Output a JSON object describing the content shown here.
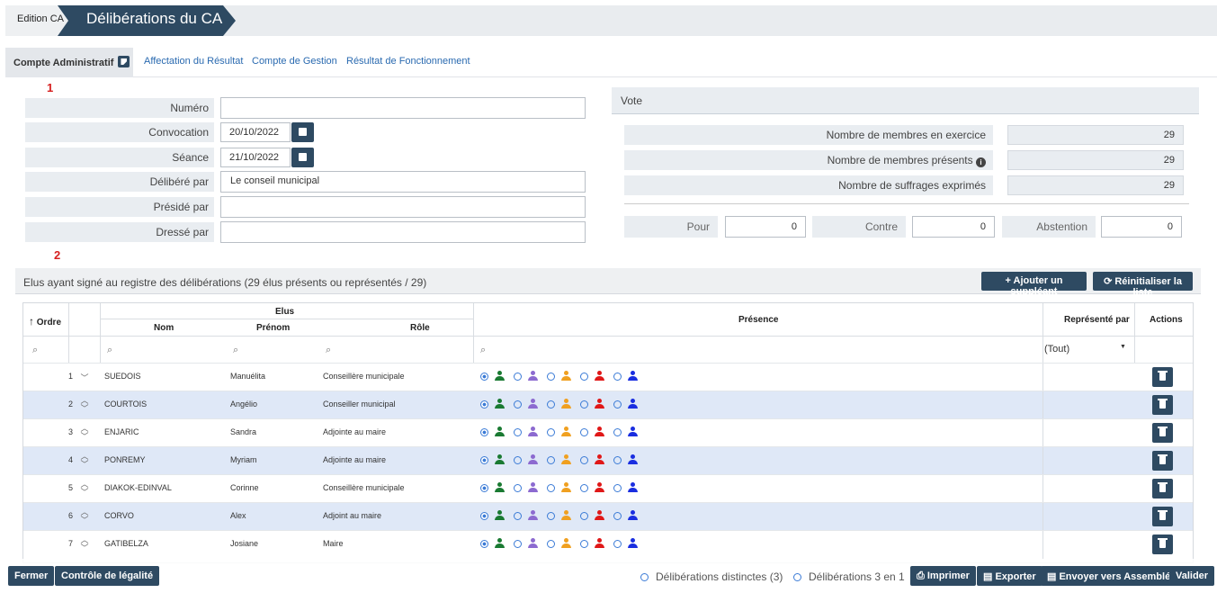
{
  "breadcrumb": {
    "parent": "Edition CA",
    "current": "Délibérations du CA"
  },
  "tabs": [
    "Compte Administratif",
    "Affectation du Résultat",
    "Compte de Gestion",
    "Résultat de Fonctionnement"
  ],
  "markers": [
    "1",
    "2"
  ],
  "form": {
    "numero": {
      "label": "Numéro",
      "value": ""
    },
    "convocation": {
      "label": "Convocation",
      "value": "20/10/2022"
    },
    "seance": {
      "label": "Séance",
      "value": "21/10/2022"
    },
    "delibere_par": {
      "label": "Délibéré par",
      "value": "Le conseil municipal"
    },
    "preside_par": {
      "label": "Présidé par",
      "value": ""
    },
    "dresse_par": {
      "label": "Dressé par",
      "value": ""
    }
  },
  "vote": {
    "title": "Vote",
    "membres_exercice_label": "Nombre de membres en exercice",
    "membres_exercice": "29",
    "membres_presents_label": "Nombre de membres présents",
    "membres_presents": "29",
    "suffrages_label": "Nombre de suffrages exprimés",
    "suffrages": "29",
    "pour_label": "Pour",
    "pour": "0",
    "contre_label": "Contre",
    "contre": "0",
    "abstention_label": "Abstention",
    "abstention": "0"
  },
  "elus_section": {
    "title": "Elus ayant signé au registre des délibérations (29 élus présents ou représentés / 29)",
    "add_label": "+ Ajouter un suppléant",
    "reset_label": "Réinitialiser la liste"
  },
  "grid": {
    "ordre": "Ordre",
    "elus": "Elus",
    "nom": "Nom",
    "prenom": "Prénom",
    "role": "Rôle",
    "presence": "Présence",
    "represente": "Représenté par",
    "actions": "Actions",
    "filter_all": "(Tout)"
  },
  "presence_colors": [
    "#1a7a32",
    "#8c6ad0",
    "#f0a020",
    "#e01818",
    "#1a2ee0"
  ],
  "rows": [
    {
      "ordre": "1",
      "nom": "SUEDOIS",
      "prenom": "Manuélita",
      "role": "Conseillère municipale"
    },
    {
      "ordre": "2",
      "nom": "COURTOIS",
      "prenom": "Angélio",
      "role": "Conseiller municipal"
    },
    {
      "ordre": "3",
      "nom": "ENJARIC",
      "prenom": "Sandra",
      "role": "Adjointe au maire"
    },
    {
      "ordre": "4",
      "nom": "PONREMY",
      "prenom": "Myriam",
      "role": "Adjointe au maire"
    },
    {
      "ordre": "5",
      "nom": "DIAKOK-EDINVAL",
      "prenom": "Corinne",
      "role": "Conseillère municipale"
    },
    {
      "ordre": "6",
      "nom": "CORVO",
      "prenom": "Alex",
      "role": "Adjoint au maire"
    },
    {
      "ordre": "7",
      "nom": "GATIBELZA",
      "prenom": "Josiane",
      "role": "Maire"
    }
  ],
  "footer": {
    "fermer": "Fermer",
    "legalite": "Contrôle de légalité",
    "opt1": "Délibérations distinctes (3)",
    "opt2": "Délibérations 3 en 1",
    "imprimer": "Imprimer",
    "exporter": "Exporter",
    "envoyer": "Envoyer vers Assemblée",
    "valider": "Valider"
  }
}
